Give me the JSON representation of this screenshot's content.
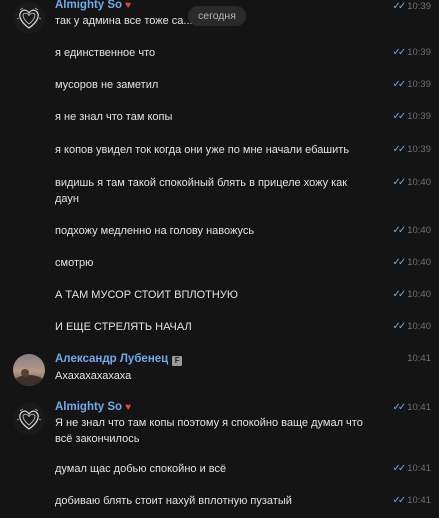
{
  "date_divider": "сегодня",
  "groups": [
    {
      "author": "Almighty So",
      "badge": "heart",
      "messages": [
        {
          "text": "так у админа все тоже са... ате",
          "time": "10:39",
          "read": true
        },
        {
          "text": "я единственное что",
          "time": "10:39",
          "read": true
        },
        {
          "text": "мусоров не заметил",
          "time": "10:39",
          "read": true
        },
        {
          "text": "я не знал что там копы",
          "time": "10:39",
          "read": true
        },
        {
          "text": "я копов увидел ток когда они уже по мне начали ебашить",
          "time": "10:39",
          "read": true
        },
        {
          "text": "видишь я там такой спокойный блять в прицеле хожу как даун",
          "time": "10:40",
          "read": true
        },
        {
          "text": "подхожу медленно на голову навожусь",
          "time": "10:40",
          "read": true
        },
        {
          "text": "смотрю",
          "time": "10:40",
          "read": true
        },
        {
          "text": "А ТАМ МУСОР СТОИТ ВПЛОТНУЮ",
          "time": "10:40",
          "read": true
        },
        {
          "text": "И ЕЩЕ СТРЕЛЯТЬ НАЧАЛ",
          "time": "10:40",
          "read": true
        }
      ]
    },
    {
      "author": "Александр Лубенец",
      "badge": "F",
      "messages": [
        {
          "text": "Ахахахахахаха",
          "time": "10:41",
          "read": false
        }
      ]
    },
    {
      "author": "Almighty So",
      "badge": "heart",
      "messages": [
        {
          "text": "Я не знал что там копы поэтому я спокойно ваще думал что всё закончилось",
          "time": "10:41",
          "read": true
        },
        {
          "text": "думал щас добью спокойно и всё",
          "time": "10:41",
          "read": true
        },
        {
          "text": "добиваю блять стоит нахуй вплотную пузатый",
          "time": "10:41",
          "read": true
        }
      ]
    }
  ],
  "colors": {
    "background": "#141414",
    "author": "#71aaeb",
    "heart": "#e64646",
    "time": "#6f7275",
    "text": "#e1e3e6"
  },
  "icons": {
    "read": "double-check-icon",
    "heart": "heart-icon"
  }
}
